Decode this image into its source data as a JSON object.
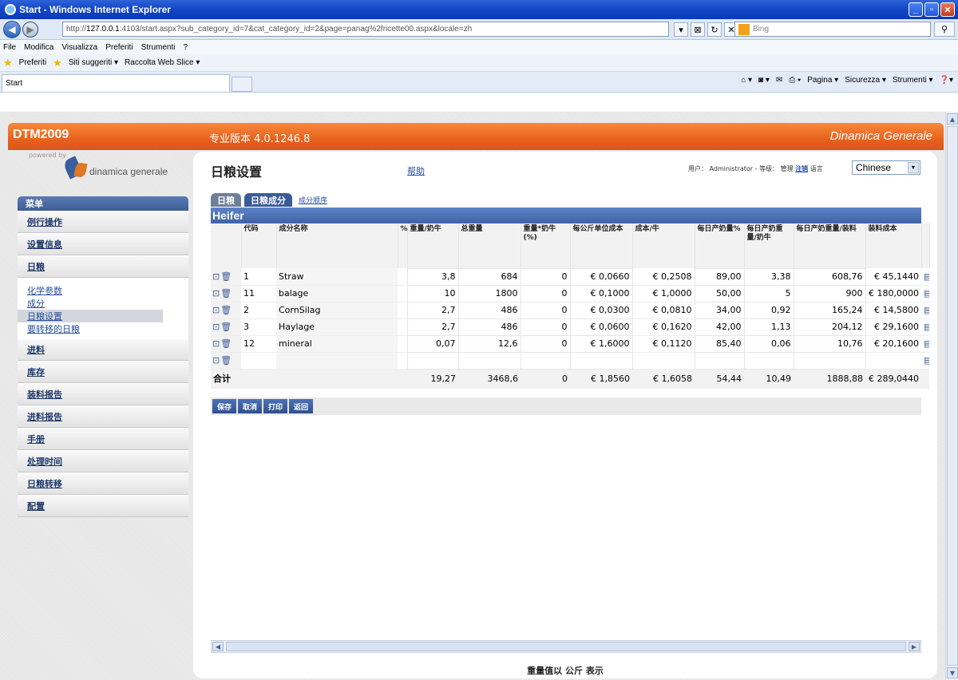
{
  "window": {
    "title": "Start - Windows Internet Explorer"
  },
  "address": {
    "url_pre": "http://",
    "url_host": "127.0.0.1",
    "url_rest": ":4103/start.aspx?sub_category_id=7&cat_category_id=2&page=panag%2fricette00.aspx&locale=zh",
    "search_placeholder": "Bing"
  },
  "menu": [
    "File",
    "Modifica",
    "Visualizza",
    "Preferiti",
    "Strumenti",
    "?"
  ],
  "favorites": {
    "label": "Preferiti",
    "suggested": "Siti suggeriti ▾",
    "webslice": "Raccolta Web Slice ▾"
  },
  "browser_tab": {
    "label": "Start"
  },
  "command_bar": [
    "Pagina ▾",
    "Sicurezza ▾",
    "Strumenti ▾"
  ],
  "app": {
    "logo": "DTM2009",
    "version": "专业版本 4.0.1246.8",
    "brand": "Dinamica Generale",
    "powered_by": "powered by",
    "company": "dinamica generale"
  },
  "sidebar": {
    "header": "菜单",
    "items_top": [
      "例行操作",
      "设置信息",
      "日粮"
    ],
    "subitems": [
      "化学参数",
      "成分",
      "日粮设置",
      "要转移的日粮"
    ],
    "items_bottom": [
      "进料",
      "库存",
      "装料报告",
      "进料报告",
      "手册",
      "处理时间",
      "日粮转移",
      "配置"
    ]
  },
  "page": {
    "title": "日粮设置",
    "help": "帮助",
    "user_label": "用户：",
    "user": "Administrator",
    "role_label": "- 等级：",
    "role": "管理",
    "logout": "注销",
    "lang_label": "语言",
    "language": "Chinese"
  },
  "tabs": [
    "日粮",
    "日粮成分",
    "成分顺序"
  ],
  "grid": {
    "group": "Heifer",
    "columns": [
      "代码",
      "成分名称",
      "%",
      "重量/奶牛",
      "总重量",
      "重量*奶牛(%)",
      "每公斤单位成本",
      "成本/牛",
      "每日产奶量%",
      "每日产奶重量/奶牛",
      "每日产奶重量/装料",
      "装料成本"
    ],
    "rows": [
      [
        "1",
        "Straw",
        "",
        "3,8",
        "684",
        "0",
        "€ 0,0660",
        "€ 0,2508",
        "89,00",
        "3,38",
        "608,76",
        "€ 45,1440"
      ],
      [
        "11",
        "balage",
        "",
        "10",
        "1800",
        "0",
        "€ 0,1000",
        "€ 1,0000",
        "50,00",
        "5",
        "900",
        "€ 180,0000"
      ],
      [
        "2",
        "CornSilag",
        "",
        "2,7",
        "486",
        "0",
        "€ 0,0300",
        "€ 0,0810",
        "34,00",
        "0,92",
        "165,24",
        "€ 14,5800"
      ],
      [
        "3",
        "Haylage",
        "",
        "2,7",
        "486",
        "0",
        "€ 0,0600",
        "€ 0,1620",
        "42,00",
        "1,13",
        "204,12",
        "€ 29,1600"
      ],
      [
        "12",
        "mineral",
        "",
        "0,07",
        "12,6",
        "0",
        "€ 1,6000",
        "€ 0,1120",
        "85,40",
        "0,06",
        "10,76",
        "€ 20,1600"
      ],
      [
        "",
        "",
        "",
        "",
        "",
        "",
        "",
        "",
        "",
        "",
        "",
        ""
      ]
    ],
    "total": [
      "合计",
      "",
      "",
      "19,27",
      "3468,6",
      "0",
      "€ 1,8560",
      "€ 1,6058",
      "54,44",
      "10,49",
      "1888,88",
      "€ 289,0440"
    ]
  },
  "buttons": [
    "保存",
    "取消",
    "打印",
    "返回"
  ],
  "footer": "重量值以 公斤 表示"
}
